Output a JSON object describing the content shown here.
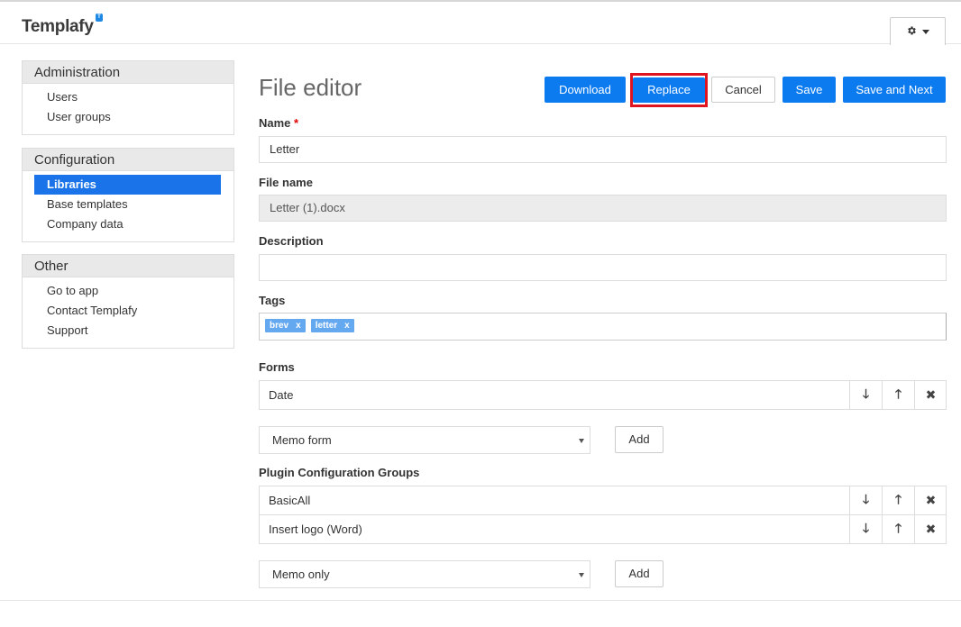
{
  "app": {
    "logo_text": "Templafy",
    "logo_badge": "T"
  },
  "header": {
    "settings_icon": "gear-icon"
  },
  "sidebar": {
    "sections": [
      {
        "title": "Administration",
        "items": [
          {
            "label": "Users"
          },
          {
            "label": "User groups"
          }
        ]
      },
      {
        "title": "Configuration",
        "items": [
          {
            "label": "Libraries",
            "active": true
          },
          {
            "label": "Base templates"
          },
          {
            "label": "Company data"
          }
        ]
      },
      {
        "title": "Other",
        "items": [
          {
            "label": "Go to app"
          },
          {
            "label": "Contact Templafy"
          },
          {
            "label": "Support"
          }
        ]
      }
    ]
  },
  "page": {
    "title": "File editor"
  },
  "toolbar": {
    "download_label": "Download",
    "replace_label": "Replace",
    "cancel_label": "Cancel",
    "save_label": "Save",
    "save_next_label": "Save and Next",
    "highlight_color": "#e0141e"
  },
  "form": {
    "name": {
      "label": "Name",
      "required_mark": "*",
      "value": "Letter"
    },
    "file_name": {
      "label": "File name",
      "value": "Letter (1).docx"
    },
    "description": {
      "label": "Description",
      "value": ""
    },
    "tags": {
      "label": "Tags",
      "items": [
        {
          "label": "brev",
          "remove": "x"
        },
        {
          "label": "letter",
          "remove": "x"
        }
      ]
    },
    "forms": {
      "label": "Forms",
      "items": [
        {
          "label": "Date"
        }
      ],
      "select_value": "Memo form",
      "add_label": "Add"
    },
    "plugin_groups": {
      "label": "Plugin Configuration Groups",
      "items": [
        {
          "label": "BasicAll"
        },
        {
          "label": "Insert logo (Word)"
        }
      ],
      "select_value": "Memo only",
      "add_label": "Add"
    }
  },
  "icons": {
    "down": "arrow-down-icon",
    "up": "arrow-up-icon",
    "remove": "close-icon"
  },
  "colors": {
    "primary": "#0d7bf0",
    "active_nav": "#1a73e8",
    "tag": "#64a8f0"
  }
}
